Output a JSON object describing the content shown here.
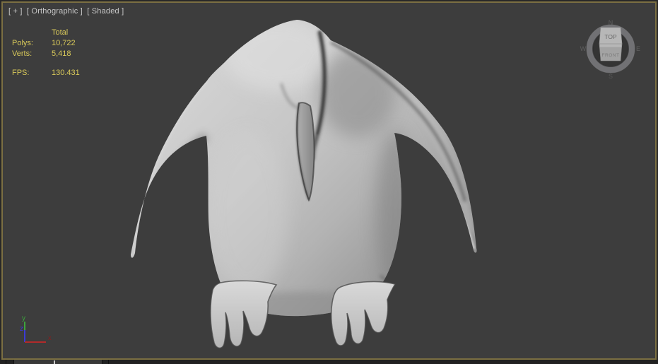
{
  "viewport": {
    "label_general": "[ + ]",
    "label_pov": "[ Orthographic ]",
    "label_shading": "[ Shaded ]",
    "background_color": "#3d3d3d",
    "active_border_color": "#7b6f42"
  },
  "statistics": {
    "header": "Total",
    "rows": [
      {
        "label": "Polys:",
        "value": "10,722"
      },
      {
        "label": "Verts:",
        "value": "5,418"
      },
      {
        "label": "FPS:",
        "value": "130.431"
      }
    ],
    "text_color": "#d9c95a"
  },
  "viewcube": {
    "top_face": "TOP",
    "front_face": "FRONT",
    "compass": {
      "north": "N",
      "east": "E",
      "south": "S",
      "west": "W"
    }
  },
  "axis_gizmo": {
    "x_label": "x",
    "y_label": "y",
    "z_label": "z",
    "x_color": "#b22a2a",
    "y_color": "#3da53d",
    "z_color": "#3b3bd6"
  }
}
